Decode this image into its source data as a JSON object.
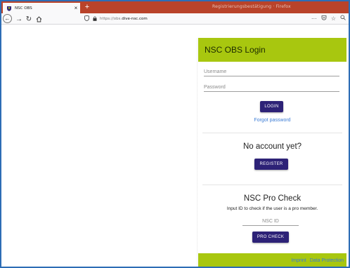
{
  "browser": {
    "tab_title": "NSC OBS",
    "tab_close": "×",
    "new_tab": "+",
    "window_title": "Registrierungsbestätigung · Firefox",
    "url_prefix": "https://obs.",
    "url_domain": "dive-nsc.com",
    "menu_glyph": "···"
  },
  "panel": {
    "title": "NSC OBS Login",
    "username_placeholder": "Username",
    "password_placeholder": "Password",
    "login_label": "LOGIN",
    "forgot_label": "Forgot password",
    "no_account_heading": "No account yet?",
    "register_label": "REGISTER",
    "pro_heading": "NSC Pro Check",
    "pro_desc": "Input ID to check if the user is a pro member.",
    "nsc_id_placeholder": "NSC ID",
    "pro_check_label": "PRO CHECK"
  },
  "footer": {
    "imprint": "Imprint",
    "data_protection": "Data Protection"
  },
  "colors": {
    "accent_green": "#a8c70f",
    "button_navy": "#2d2277",
    "link_blue": "#3a7bd5",
    "tabbar_red": "#b9432a",
    "frame_blue": "#2d6db5"
  }
}
